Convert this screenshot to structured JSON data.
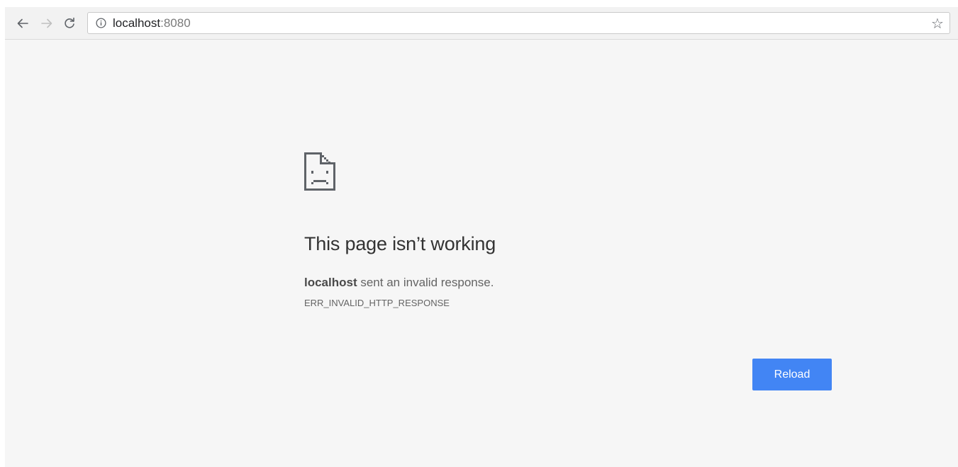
{
  "browser": {
    "address_bar": {
      "host": "localhost",
      "port": ":8080"
    },
    "icons": {
      "back": "arrow-left-icon",
      "forward": "arrow-right-icon",
      "reload": "reload-icon",
      "info": "info-icon",
      "bookmark": "star-icon"
    }
  },
  "error_page": {
    "icon": "sad-page-icon",
    "title": "This page isn’t working",
    "host": "localhost",
    "message": " sent an invalid response.",
    "code": "ERR_INVALID_HTTP_RESPONSE",
    "reload_label": "Reload",
    "accent_color": "#4285f4"
  }
}
